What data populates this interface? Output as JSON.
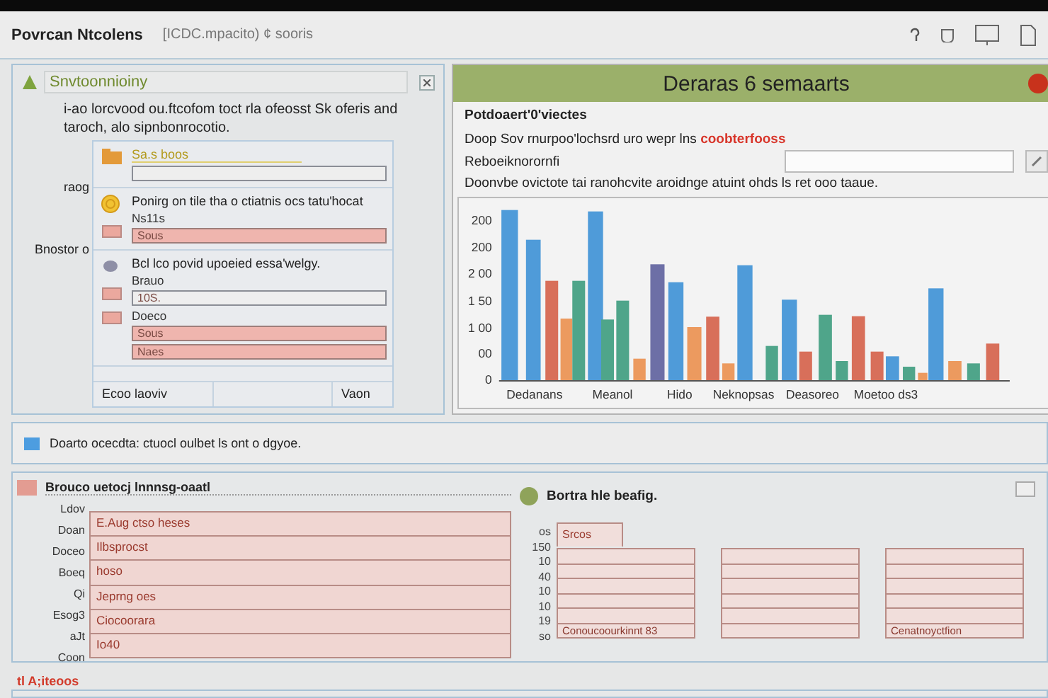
{
  "header": {
    "title": "Povrcan Ntcolens",
    "subtitle": "[ICDC.mpacito) ¢ sooris"
  },
  "setup_panel": {
    "title": "Snvtoonnioiny",
    "description": "i-ao lorcvood ou.ftcofom toct rla ofeosst Sk oferis and taroch, alo sipnbonrocotio.",
    "side_labels": [
      "raog",
      "Bnostor o"
    ],
    "sections": [
      {
        "kind": "folder",
        "title": "Sa.s boos",
        "fields": [
          {
            "filled": false
          }
        ]
      },
      {
        "kind": "coin",
        "title": "Ponirg on tile tha o ctiatnis ocs tatu'hocat",
        "fields": [
          {
            "label": "Ns11s",
            "value": "Sous",
            "filled": true
          }
        ]
      },
      {
        "kind": "mouse",
        "title": "Bcl lco povid upoeied essa'welgy.",
        "fields": [
          {
            "label": "Brauo",
            "value": "10S.",
            "filled": false
          },
          {
            "label": "Doeco",
            "value": "Sous",
            "filled": true
          },
          {
            "value": "Naes",
            "filled": true
          }
        ]
      }
    ],
    "footer": [
      "Ecoo laoviv",
      "Vaon"
    ]
  },
  "summary_panel": {
    "title": "Deraras 6 semaarts",
    "heading": "Potdoaert'0'viectes",
    "line": {
      "text": "Doop Sov rnurpoo'lochsrd uro wepr lns",
      "highlight": "coobterfooss"
    },
    "field_label": "Reboeiknorornfi",
    "note": "Doonvbe ovictote tai ranohcvite aroidnge atuint ohds ls ret ooo taaue.",
    "chart": {
      "y_labels": [
        "200",
        "200",
        "2 00",
        "1 50",
        "1 00",
        "00",
        "0"
      ],
      "categories": [
        "Dedanans",
        "Meanol",
        "Hido",
        "Neknopsas",
        "Deasoreo",
        "Moetoo ds3"
      ]
    }
  },
  "info_bar": {
    "text": "Doarto ocecdta: ctuocl oulbet ls ont o dgyoe."
  },
  "form_panel": {
    "title": "Brouco uetocj lnnnsg-oaatl",
    "labels": [
      "Ldov",
      "Doan",
      "Doceo",
      "Boeq",
      "Qi",
      "Esog3",
      "aJt",
      "Coon"
    ],
    "rows": [
      "E.Aug ctso heses",
      "Ilbsprocst",
      "hoso",
      "Jeprng oes",
      "Ciocoorara",
      "Io40"
    ]
  },
  "tables_panel": {
    "title": "Bortra hle beafig.",
    "y_labels": [
      "os",
      "150",
      "10",
      "40",
      "10",
      "10",
      "19",
      "so"
    ],
    "tables": [
      {
        "kind": "grid",
        "tab": "Srcos",
        "caption": "Conoucoourkinnt 83"
      },
      {
        "kind": "grid"
      },
      {
        "kind": "grid",
        "caption": "Cenatnoyctfion"
      }
    ]
  },
  "footer": {
    "text": "tl A;iteoos"
  }
}
